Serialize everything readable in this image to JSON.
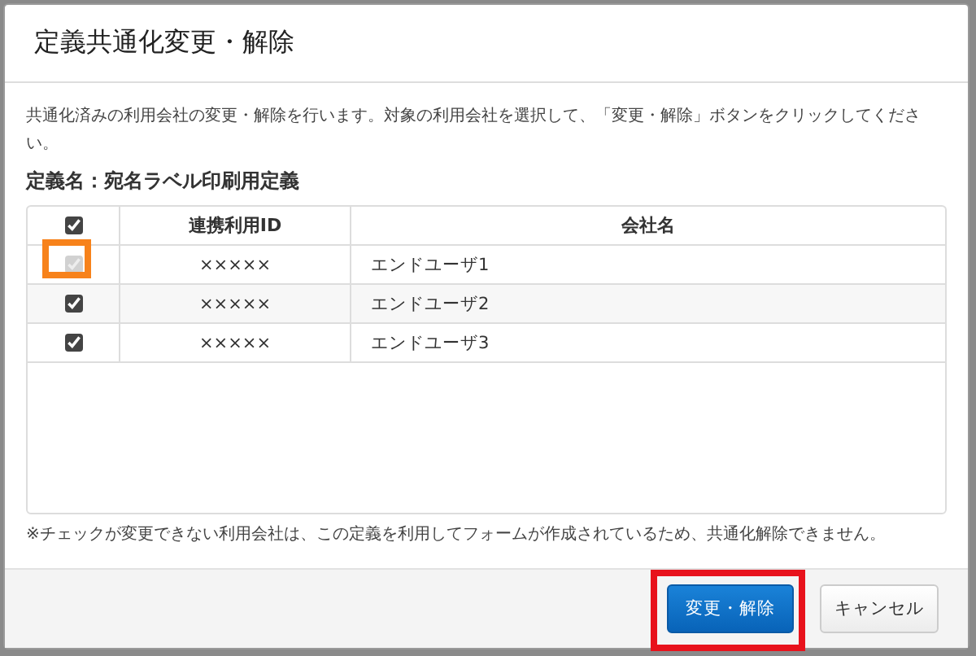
{
  "dialog": {
    "title": "定義共通化変更・解除"
  },
  "description": "共通化済みの利用会社の変更・解除を行います。対象の利用会社を選択して、「変更・解除」ボタンをクリックしてください。",
  "definition_name": "定義名：宛名ラベル印刷用定義",
  "table": {
    "header_checked": true,
    "columns": [
      "連携利用ID",
      "会社名"
    ],
    "rows": [
      {
        "id": "×××××",
        "company": "エンドユーザ1",
        "checked": true,
        "disabled": true,
        "highlighted": true
      },
      {
        "id": "×××××",
        "company": "エンドユーザ2",
        "checked": true,
        "disabled": false,
        "highlighted": false
      },
      {
        "id": "×××××",
        "company": "エンドユーザ3",
        "checked": true,
        "disabled": false,
        "highlighted": false
      }
    ]
  },
  "note": "※チェックが変更できない利用会社は、この定義を利用してフォームが作成されているため、共通化解除できません。",
  "buttons": [
    {
      "label": "変更・解除",
      "kind": "primary",
      "highlighted": true
    },
    {
      "label": "キャンセル",
      "kind": "secondary",
      "highlighted": false
    }
  ]
}
